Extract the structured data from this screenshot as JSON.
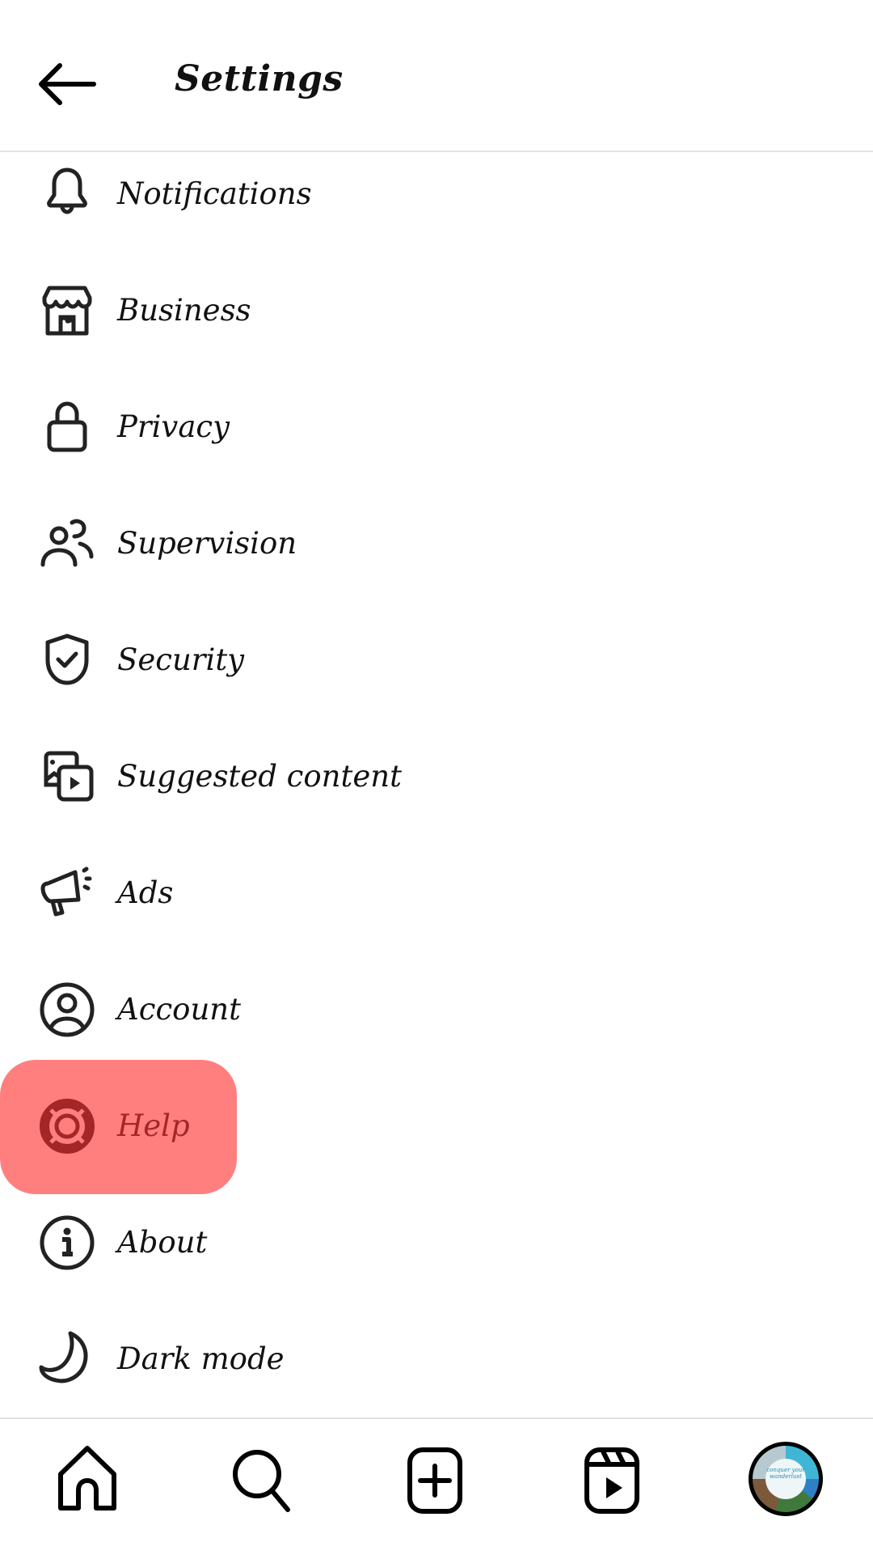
{
  "header": {
    "title": "Settings",
    "back_icon": "arrow-left-icon"
  },
  "menu": {
    "items": [
      {
        "label": "Notifications",
        "icon": "bell-icon"
      },
      {
        "label": "Business",
        "icon": "storefront-icon"
      },
      {
        "label": "Privacy",
        "icon": "lock-icon"
      },
      {
        "label": "Supervision",
        "icon": "people-icon"
      },
      {
        "label": "Security",
        "icon": "shield-check-icon"
      },
      {
        "label": "Suggested content",
        "icon": "media-play-icon"
      },
      {
        "label": "Ads",
        "icon": "megaphone-icon"
      },
      {
        "label": "Account",
        "icon": "user-circle-icon"
      },
      {
        "label": "Help",
        "icon": "lifebuoy-icon",
        "highlighted": true
      },
      {
        "label": "About",
        "icon": "info-circle-icon"
      },
      {
        "label": "Dark mode",
        "icon": "moon-icon"
      }
    ],
    "highlight_color": "#ff7f7f",
    "highlight_text_color": "#a52626"
  },
  "bottom_nav": {
    "items": [
      {
        "name": "home",
        "icon": "home-icon"
      },
      {
        "name": "search",
        "icon": "search-icon"
      },
      {
        "name": "create",
        "icon": "plus-square-icon"
      },
      {
        "name": "reels",
        "icon": "reels-icon"
      },
      {
        "name": "profile",
        "icon": "avatar"
      }
    ],
    "avatar_text": "conquer your wanderlust"
  }
}
